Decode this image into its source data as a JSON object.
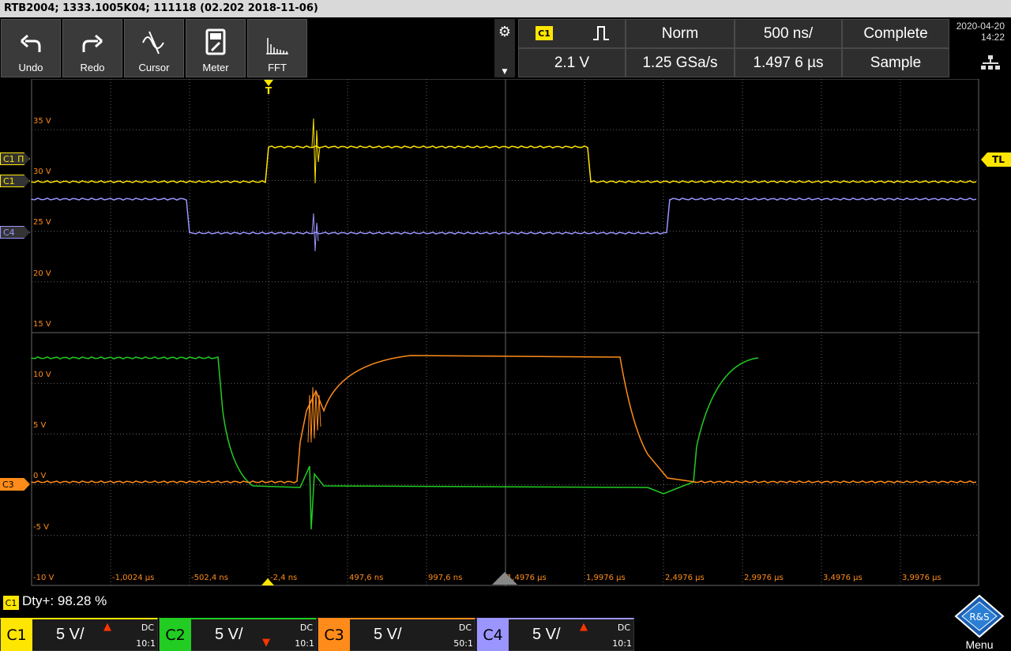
{
  "titlebar": "RTB2004; 1333.1005K04; 111118 (02.202 2018-11-06)",
  "toolbar": {
    "buttons": [
      {
        "label": "Undo",
        "icon": "undo-icon"
      },
      {
        "label": "Redo",
        "icon": "redo-icon"
      },
      {
        "label": "Cursor",
        "icon": "cursor-icon"
      },
      {
        "label": "Meter",
        "icon": "meter-icon"
      },
      {
        "label": "FFT",
        "icon": "fft-icon"
      }
    ],
    "trigger_source": "C1",
    "trigger_level": "2.1 V",
    "trigger_mode": "Norm",
    "timebase": "500 ns/",
    "sample_rate": "1.25 GSa/s",
    "trigger_position": "1.497 6 µs",
    "acq_state": "Complete",
    "acq_mode": "Sample",
    "date": "2020-04-20",
    "time": "14:22"
  },
  "grid": {
    "vlabels": [
      "35 V",
      "30 V",
      "25 V",
      "20 V",
      "15 V",
      "10 V",
      "5 V",
      "0 V",
      "-5 V",
      "-10 V"
    ],
    "hlabels": [
      "-1,0024 µs",
      "-502,4 ns",
      "-2,4 ns",
      "497,6 ns",
      "997,6 ns",
      "1,4976 µs",
      "1,9976 µs",
      "2,4976 µs",
      "2,9976 µs",
      "3,4976 µs",
      "3,9976 µs"
    ],
    "trigger_marker": "T",
    "trigger_level_tag": "TL"
  },
  "channel_tags": {
    "c1a": "C1 Π",
    "c1b": "C1",
    "c4": "C4",
    "c3": "C3"
  },
  "measurement": {
    "badge": "C1",
    "text": "Dty+: 98.28 %"
  },
  "channels": [
    {
      "name": "C1",
      "scale": "5 V/",
      "coupling": "DC",
      "probe": "10:1",
      "color": "#ffe600"
    },
    {
      "name": "C2",
      "scale": "5 V/",
      "coupling": "DC",
      "probe": "10:1",
      "color": "#22cc22"
    },
    {
      "name": "C3",
      "scale": "5 V/",
      "coupling": "DC",
      "probe": "50:1",
      "color": "#ff8c1a"
    },
    {
      "name": "C4",
      "scale": "5 V/",
      "coupling": "DC",
      "probe": "10:1",
      "color": "#9b95ff"
    }
  ],
  "menu_label": "Menu",
  "logo_text": "R&S"
}
